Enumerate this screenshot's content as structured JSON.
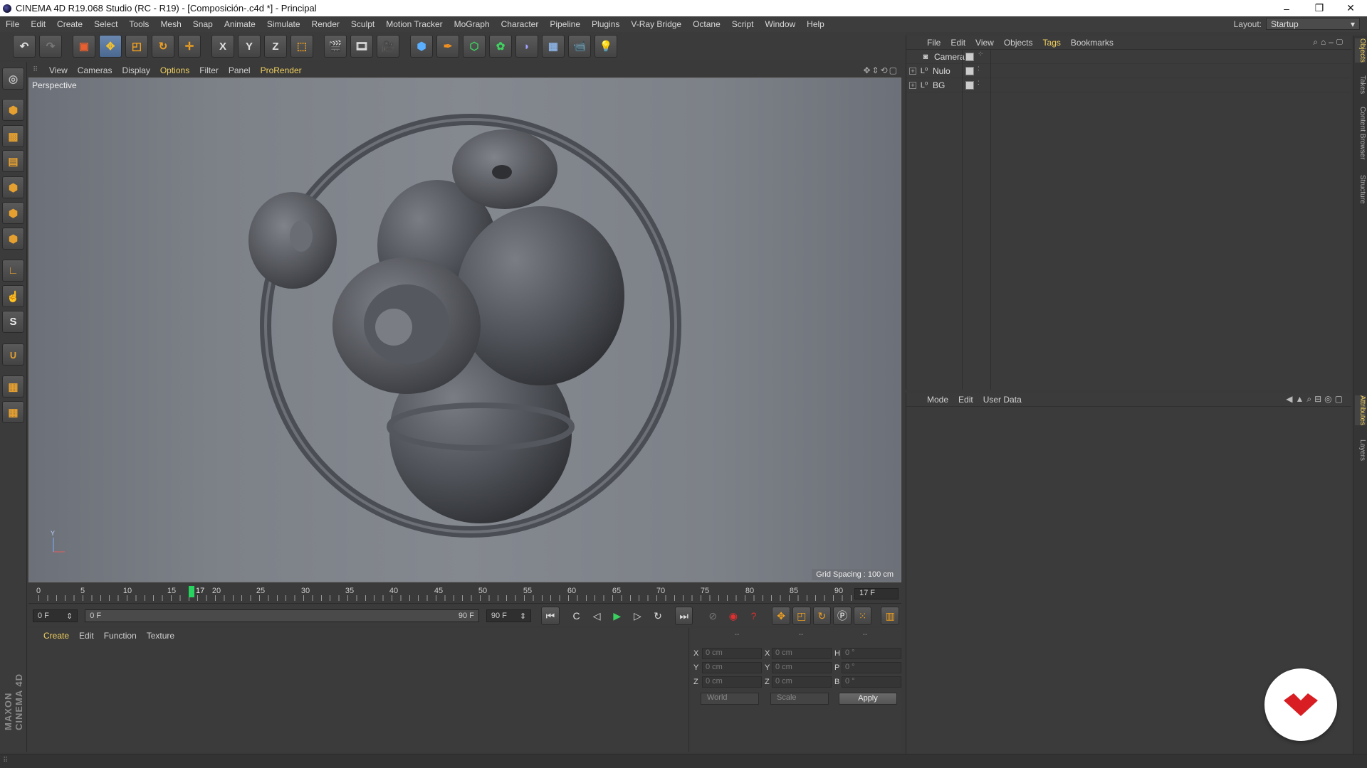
{
  "titlebar": {
    "title": "CINEMA 4D R19.068 Studio (RC - R19) - [Composición-.c4d *] - Principal",
    "minimize": "–",
    "restore": "❐",
    "close": "✕"
  },
  "menubar": {
    "items": [
      "File",
      "Edit",
      "Create",
      "Select",
      "Tools",
      "Mesh",
      "Snap",
      "Animate",
      "Simulate",
      "Render",
      "Sculpt",
      "Motion Tracker",
      "MoGraph",
      "Character",
      "Pipeline",
      "Plugins",
      "V-Ray Bridge",
      "Octane",
      "Script",
      "Window",
      "Help"
    ],
    "layout_label": "Layout:",
    "layout_value": "Startup"
  },
  "toolbar": {
    "axis_x": "X",
    "axis_y": "Y",
    "axis_z": "Z"
  },
  "viewport_menu": {
    "items": [
      "View",
      "Cameras",
      "Display",
      "Options",
      "Filter",
      "Panel",
      "ProRender"
    ],
    "label": "Perspective",
    "grid_spacing": "Grid Spacing : 100 cm",
    "axis_y": "Y"
  },
  "timeline": {
    "ticks": [
      "0",
      "5",
      "10",
      "15",
      "20",
      "25",
      "30",
      "35",
      "40",
      "45",
      "50",
      "55",
      "60",
      "65",
      "70",
      "75",
      "80",
      "85",
      "90"
    ],
    "current": "17",
    "current_frame": "17 F"
  },
  "transport": {
    "start_field": "0 F",
    "range_start": "0 F",
    "range_end": "90 F",
    "end_field": "90 F"
  },
  "materials": {
    "tabs": [
      "Create",
      "Edit",
      "Function",
      "Texture"
    ]
  },
  "coords": {
    "header": [
      "--",
      "--",
      "--"
    ],
    "rows": [
      {
        "a1": "X",
        "v1": "0 cm",
        "a2": "X",
        "v2": "0 cm",
        "a3": "H",
        "v3": "0 °"
      },
      {
        "a1": "Y",
        "v1": "0 cm",
        "a2": "Y",
        "v2": "0 cm",
        "a3": "P",
        "v3": "0 °"
      },
      {
        "a1": "Z",
        "v1": "0 cm",
        "a2": "Z",
        "v2": "0 cm",
        "a3": "B",
        "v3": "0 °"
      }
    ],
    "space": "World",
    "mode": "Scale",
    "apply": "Apply"
  },
  "object_manager": {
    "tabs": [
      "File",
      "Edit",
      "View",
      "Objects",
      "Tags",
      "Bookmarks"
    ],
    "objects": [
      "Camera",
      "Nulo",
      "BG"
    ]
  },
  "attributes": {
    "tabs": [
      "Mode",
      "Edit",
      "User Data"
    ]
  },
  "right_tabs": [
    "Objects",
    "Takes",
    "Content Browser",
    "Structure",
    "Attributes",
    "Layers"
  ],
  "branding": {
    "maxon": "MAXON CINEMA 4D"
  },
  "colors": {
    "accent": "#f0d060",
    "playhead": "#27d45f",
    "badge_red": "#d81e22"
  }
}
